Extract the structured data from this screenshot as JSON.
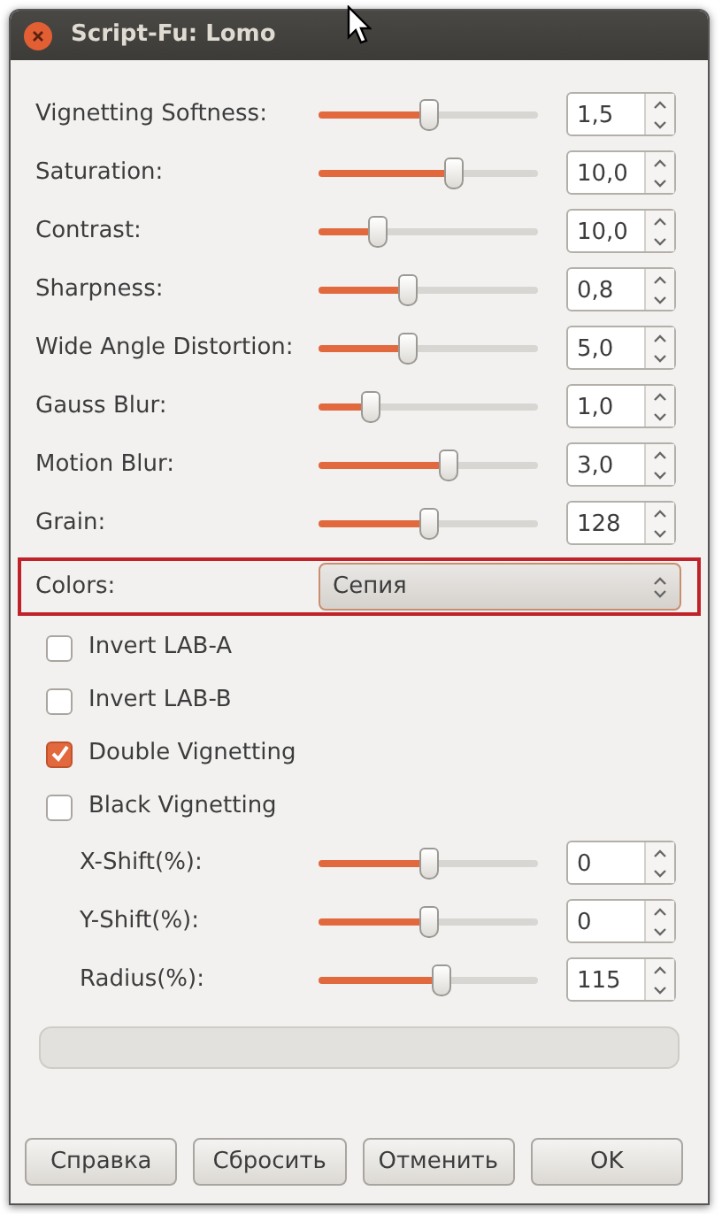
{
  "window": {
    "title": "Script-Fu: Lomo"
  },
  "controls": [
    {
      "kind": "slider",
      "label": "Vignetting Softness:",
      "level": 0.5,
      "value": "1,5"
    },
    {
      "kind": "slider",
      "label": "Saturation:",
      "level": 0.61,
      "value": "10,0"
    },
    {
      "kind": "slider",
      "label": "Contrast:",
      "level": 0.27,
      "value": "10,0"
    },
    {
      "kind": "slider",
      "label": "Sharpness:",
      "level": 0.4,
      "value": "0,8"
    },
    {
      "kind": "slider",
      "label": "Wide Angle Distortion:",
      "level": 0.4,
      "value": "5,0"
    },
    {
      "kind": "slider",
      "label": "Gauss Blur:",
      "level": 0.23,
      "value": "1,0"
    },
    {
      "kind": "slider",
      "label": "Motion Blur:",
      "level": 0.59,
      "value": "3,0"
    },
    {
      "kind": "slider",
      "label": "Grain:",
      "level": 0.5,
      "value": "128"
    },
    {
      "kind": "dropdown",
      "label": "Colors:",
      "value": "Сепия",
      "highlighted": true
    },
    {
      "kind": "checkbox",
      "label": "Invert LAB-A",
      "checked": false
    },
    {
      "kind": "checkbox",
      "label": "Invert LAB-B",
      "checked": false
    },
    {
      "kind": "checkbox",
      "label": "Double Vignetting",
      "checked": true
    },
    {
      "kind": "checkbox",
      "label": "Black Vignetting",
      "checked": false,
      "children": [
        {
          "kind": "slider",
          "label": "X-Shift(%):",
          "level": 0.5,
          "value": "0"
        },
        {
          "kind": "slider",
          "label": "Y-Shift(%):",
          "level": 0.5,
          "value": "0"
        },
        {
          "kind": "slider",
          "label": "Radius(%):",
          "level": 0.56,
          "value": "115"
        }
      ]
    }
  ],
  "progress_bar": {
    "level": 0
  },
  "buttons": [
    "Справка",
    "Сбросить",
    "Отменить",
    "OK"
  ]
}
